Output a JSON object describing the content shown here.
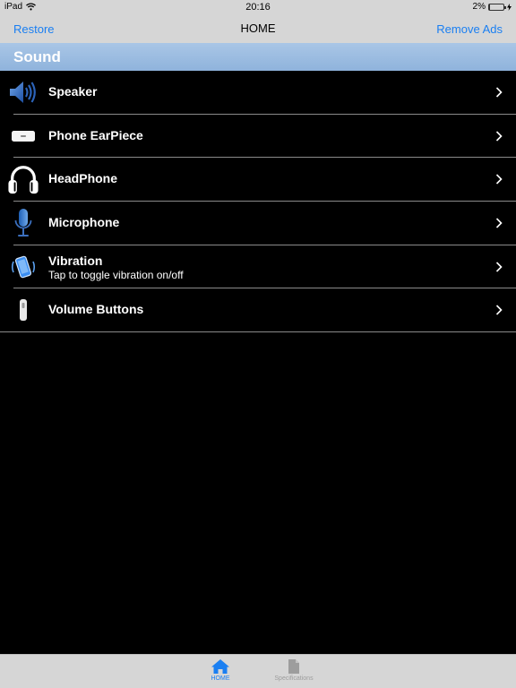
{
  "status_bar": {
    "device": "iPad",
    "time": "20:16",
    "battery_percent_label": "2%",
    "battery_level": 0.02
  },
  "nav": {
    "left_button": "Restore",
    "title": "HOME",
    "right_button": "Remove Ads",
    "accent_color": "#1a7ff2"
  },
  "section": {
    "title": "Sound"
  },
  "items": [
    {
      "title": "Speaker",
      "icon": "speaker-icon"
    },
    {
      "title": "Phone EarPiece",
      "icon": "earpiece-icon"
    },
    {
      "title": "HeadPhone",
      "icon": "headphones-icon"
    },
    {
      "title": "Microphone",
      "icon": "microphone-icon"
    },
    {
      "title": "Vibration",
      "subtitle": "Tap to toggle vibration on/off",
      "icon": "vibration-icon"
    },
    {
      "title": "Volume Buttons",
      "icon": "volume-buttons-icon"
    }
  ],
  "tabs": [
    {
      "label": "HOME",
      "icon": "home-icon",
      "selected": true
    },
    {
      "label": "Specifications",
      "icon": "document-icon",
      "selected": false
    }
  ]
}
